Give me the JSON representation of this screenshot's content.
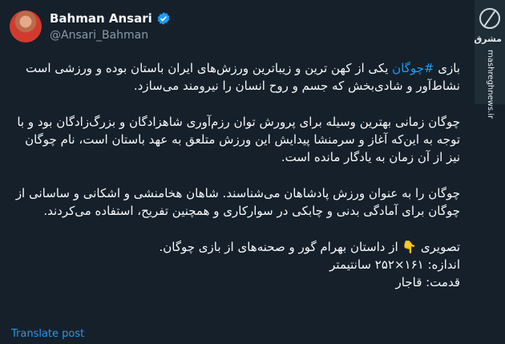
{
  "author": {
    "display_name": "Bahman Ansari",
    "handle": "@Ansari_Bahman"
  },
  "watermark": {
    "brand": "مشرق",
    "site": "mashreghnews.ir"
  },
  "tweet": {
    "p1_prefix": "بازی ",
    "p1_hashtag": "#چوگان",
    "p1_rest": " یکی از کهن ترین و زیباترین ورزش‌های ایران باستان بوده و ورزشی است نشاط‌آور و شادی‌بخش که جسم و روح انسان را نیرومند می‌سازد.",
    "p2": "چوگان زمانی بهترین وسیله برای پرورش توان رزم‌آوری شاهزادگان و بزرگ‌زادگان بود و با توجه به این‌که آغاز و سرمنشا پیدایش این ورزش متلعق به عهد باستان است، نام چوگان نیز از آن زمان به یادگار مانده است.",
    "p3": "چوگان را به عنوان ورزش پادشاهان می‌شناسند. شاهان هخامنشی و اشکانی و ساسانی از چوگان برای آمادگی بدنی و چابکی در سوارکاری و همچنین تفریح، استفاده می‌کردند.",
    "p4_line1": "تصویری 👇 از داستان بهرام گور و صحنه‌های از بازی چوگان.",
    "p4_line2": "اندازه: ۱۶۱×۲۵۲ سانتیمتر",
    "p4_line3": "قدمت: قاجار"
  },
  "translate_label": "Translate post",
  "colors": {
    "background": "#15202b",
    "text": "#f7f9f9",
    "muted": "#8b98a5",
    "accent": "#1d9bf0"
  }
}
